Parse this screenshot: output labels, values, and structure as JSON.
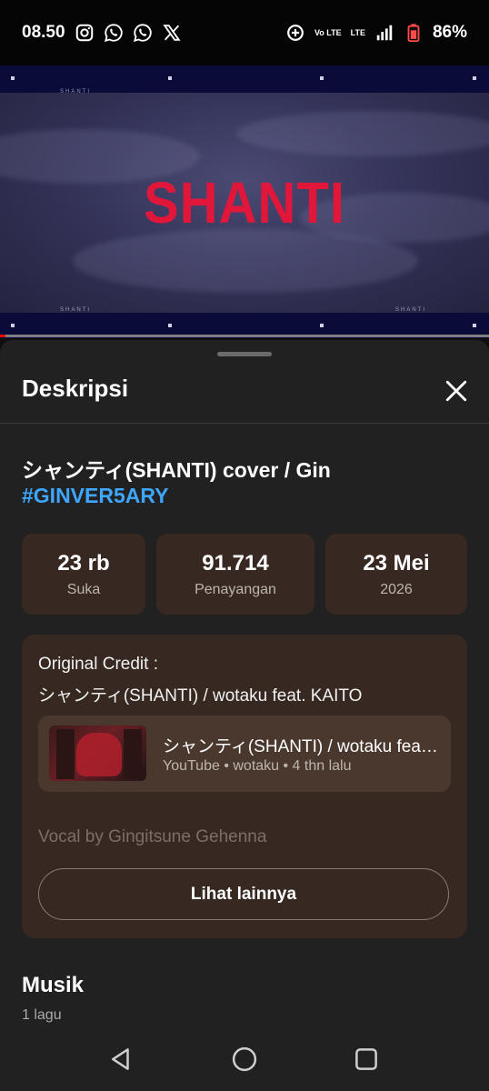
{
  "status_bar": {
    "time": "08.50",
    "battery": "86%",
    "net_top": "Vo LTE",
    "net_bottom": "LTE"
  },
  "video": {
    "title_text": "SHANTI",
    "small_text_top": "SHANTI",
    "small_text_bottom_left": "SHANTI",
    "small_text_bottom_right": "SHANTI"
  },
  "sheet": {
    "header": "Deskripsi",
    "video_title": "シャンティ(SHANTI) cover / Gin",
    "hashtag": "#GINVER5ARY",
    "stats": [
      {
        "value": "23 rb",
        "label": "Suka"
      },
      {
        "value": "91.714",
        "label": "Penayangan"
      },
      {
        "value": "23 Mei",
        "label": "2026"
      }
    ],
    "credit": {
      "line1": "Original Credit :",
      "line2": "シャンティ(SHANTI) / wotaku feat. KAITO",
      "related_title": "シャンティ(SHANTI) / wotaku feat. KAITO",
      "related_meta": "YouTube • wotaku • 4 thn lalu",
      "faded_line": "Vocal by Gingitsune Gehenna",
      "more_button": "Lihat lainnya"
    },
    "music": {
      "title": "Musik",
      "count": "1 lagu"
    }
  },
  "icons": {
    "status_left": [
      "instagram-icon",
      "whatsapp-icon",
      "whatsapp-icon",
      "x-icon"
    ],
    "status_right": [
      "data-saver-icon",
      "volte-icon",
      "signal-icon",
      "battery-icon"
    ],
    "sheet": [
      "close-icon"
    ],
    "nav": [
      "back-icon",
      "home-icon",
      "recents-icon"
    ]
  },
  "colors": {
    "hashtag": "#3ea6ff",
    "card": "#372922",
    "video_title": "#e0163b"
  }
}
